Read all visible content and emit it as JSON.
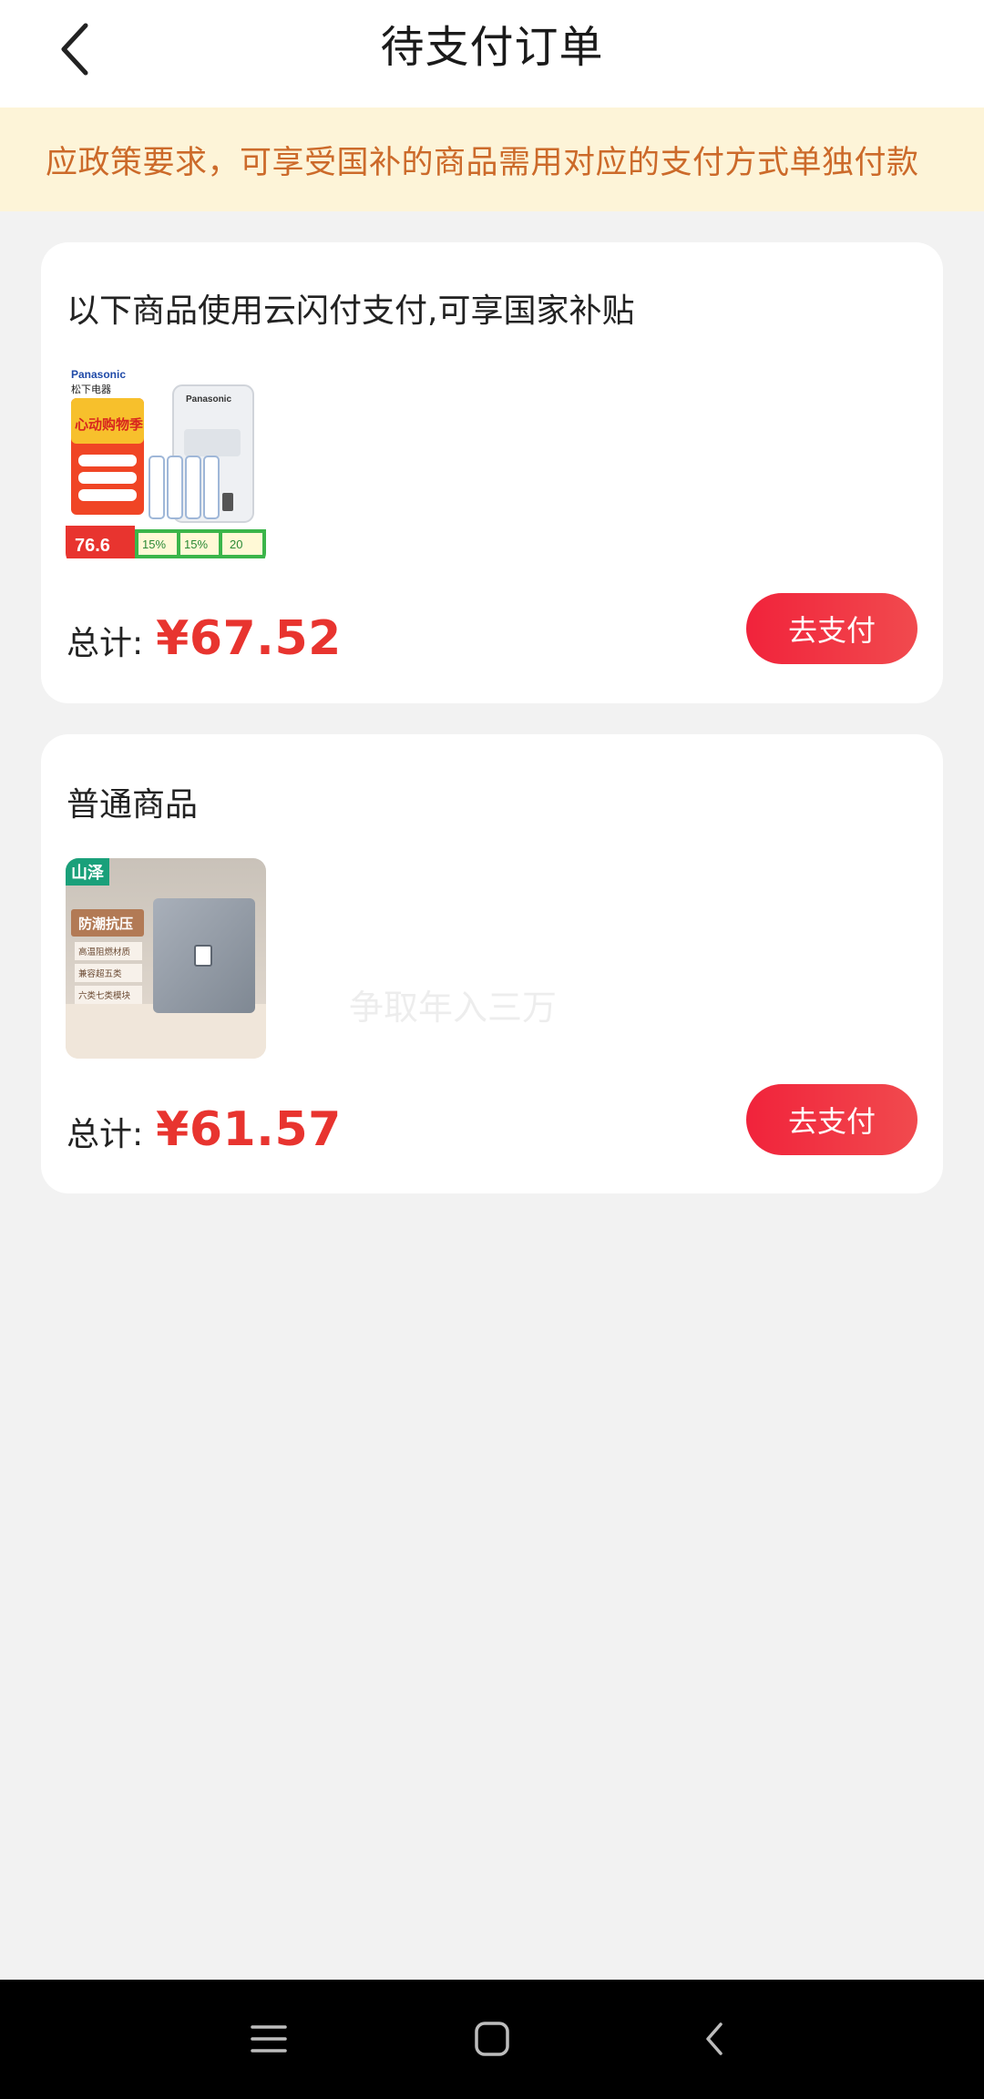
{
  "header": {
    "title": "待支付订单",
    "back_icon": "chevron-left-icon"
  },
  "notice": {
    "text": "应政策要求，可享受国补的商品需用对应的支付方式单独付款"
  },
  "orders": [
    {
      "title": "以下商品使用云闪付支付,可享国家补贴",
      "product_image": {
        "brand": "Panasonic",
        "brand_cn": "松下电器",
        "promo": "心动购物季",
        "price_tag": "76.6",
        "discounts": [
          "15%",
          "15%",
          "20"
        ]
      },
      "total_label": "总计:",
      "total_amount": "¥67.52",
      "pay_button": "去支付"
    },
    {
      "title": "普通商品",
      "product_image": {
        "brand": "山泽",
        "headline": "防潮抗压",
        "features": [
          "高温阻燃材质",
          "兼容超五类",
          "六类七类模块"
        ]
      },
      "total_label": "总计:",
      "total_amount": "¥61.57",
      "pay_button": "去支付"
    }
  ],
  "watermark": "争取年入三万",
  "nav": {
    "menu_icon": "menu-icon",
    "home_icon": "home-icon",
    "back_icon": "back-icon"
  },
  "colors": {
    "accent": "#e8342f",
    "notice_bg": "#fdf4d8",
    "notice_text": "#cc6a2a",
    "page_bg": "#f2f2f2"
  }
}
